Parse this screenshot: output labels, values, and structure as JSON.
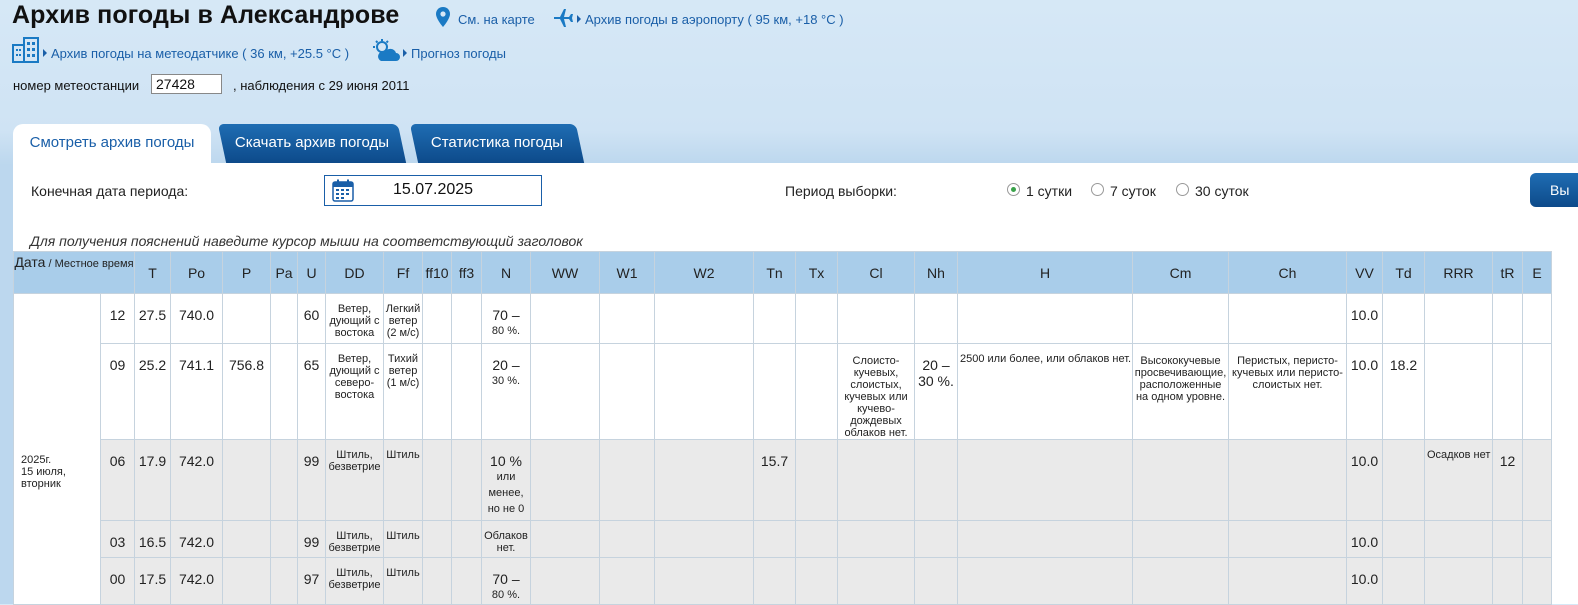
{
  "page": {
    "title": "Архив погоды в Александрове",
    "map_link": "См. на карте",
    "airport_link": "Архив погоды в аэропорту ( 95 км, +18 °C )",
    "sensor_link": "Архив погоды на метеодатчике ( 36 км, +25.5 °C )",
    "forecast_link": "Прогноз погоды",
    "station_label": "номер метеостанции",
    "station_number": "27428",
    "observations": ", наблюдения с 29 июня 2011"
  },
  "tabs": [
    {
      "label": "Смотреть архив погоды",
      "active": true
    },
    {
      "label": "Скачать архив погоды",
      "active": false
    },
    {
      "label": "Статистика погоды",
      "active": false
    }
  ],
  "filters": {
    "end_date_label": "Конечная дата периода:",
    "end_date": "15.07.2025",
    "period_label": "Период выборки:",
    "periods": [
      "1 сутки",
      "7 суток",
      "30 суток"
    ],
    "selected_period": "1 сутки",
    "show_button": "Вы"
  },
  "hint": "Для получения пояснений наведите курсор мыши на соответствующий заголовок",
  "table": {
    "date_header_main": "Дата",
    "date_header_sub": " / Местное время",
    "columns": [
      "T",
      "Po",
      "P",
      "Pa",
      "U",
      "DD",
      "Ff",
      "ff10",
      "ff3",
      "N",
      "WW",
      "W1",
      "W2",
      "Tn",
      "Tx",
      "Cl",
      "Nh",
      "H",
      "Cm",
      "Ch",
      "VV",
      "Td",
      "RRR",
      "tR",
      "E"
    ],
    "date_cell": [
      "2025г.",
      "15 июля,",
      "вторник"
    ],
    "rows": [
      {
        "time": "12",
        "T": "27.5",
        "Po": "740.0",
        "P": "",
        "Pa": "",
        "U": "60",
        "DD": "Ветер, дующий с востока",
        "Ff": "Легкий ветер (2 м/с)",
        "N_main": "70 –",
        "N_sub": "80 %.",
        "Tn": "",
        "Cl": "",
        "Nh": "",
        "H": "",
        "Cm": "",
        "Ch": "",
        "VV": "10.0",
        "Td": "",
        "RRR": "",
        "tR": ""
      },
      {
        "time": "09",
        "T": "25.2",
        "Po": "741.1",
        "P": "756.8",
        "Pa": "",
        "U": "65",
        "DD": "Ветер, дующий с северо-востока",
        "Ff": "Тихий ветер (1 м/с)",
        "N_main": "20 –",
        "N_sub": "30 %.",
        "Tn": "",
        "Cl": "Слоисто-кучевых, слоистых, кучевых или кучево-дождевых облаков нет.",
        "Nh": "20 – 30 %.",
        "H": "2500 или более, или облаков нет.",
        "Cm": "Высококучевые просвечивающие, расположенные на одном уровне.",
        "Ch": "Перистых, перисто-кучевых или перисто-слоистых нет.",
        "VV": "10.0",
        "Td": "18.2",
        "RRR": "",
        "tR": ""
      },
      {
        "time": "06",
        "T": "17.9",
        "Po": "742.0",
        "P": "",
        "Pa": "",
        "U": "99",
        "DD": "Штиль, безветрие",
        "Ff": "Штиль",
        "N_main": "10 %",
        "N_sub": "или менее, но не 0",
        "Tn": "15.7",
        "Cl": "",
        "Nh": "",
        "H": "",
        "Cm": "",
        "Ch": "",
        "VV": "10.0",
        "Td": "",
        "RRR": "Осадков нет",
        "tR": "12"
      },
      {
        "time": "03",
        "T": "16.5",
        "Po": "742.0",
        "P": "",
        "Pa": "",
        "U": "99",
        "DD": "Штиль, безветрие",
        "Ff": "Штиль",
        "N_main": "",
        "N_sub": "Облаков нет.",
        "Tn": "",
        "Cl": "",
        "Nh": "",
        "H": "",
        "Cm": "",
        "Ch": "",
        "VV": "10.0",
        "Td": "",
        "RRR": "",
        "tR": ""
      },
      {
        "time": "00",
        "T": "17.5",
        "Po": "742.0",
        "P": "",
        "Pa": "",
        "U": "97",
        "DD": "Штиль, безветрие",
        "Ff": "Штиль",
        "N_main": "70 –",
        "N_sub": "80 %.",
        "Tn": "",
        "Cl": "",
        "Nh": "",
        "H": "",
        "Cm": "",
        "Ch": "",
        "VV": "10.0",
        "Td": "",
        "RRR": "",
        "tR": ""
      }
    ]
  },
  "colors": {
    "accent": "#1a5fa8",
    "tab_dark": "#0d4a8a",
    "header_bg": "#a9cdea",
    "row_gray": "#eaeaea",
    "radio_on": "#3aa24a"
  },
  "icons": [
    "map-pin-icon",
    "airplane-icon",
    "building-icon",
    "cloud-sun-icon",
    "calendar-icon"
  ]
}
